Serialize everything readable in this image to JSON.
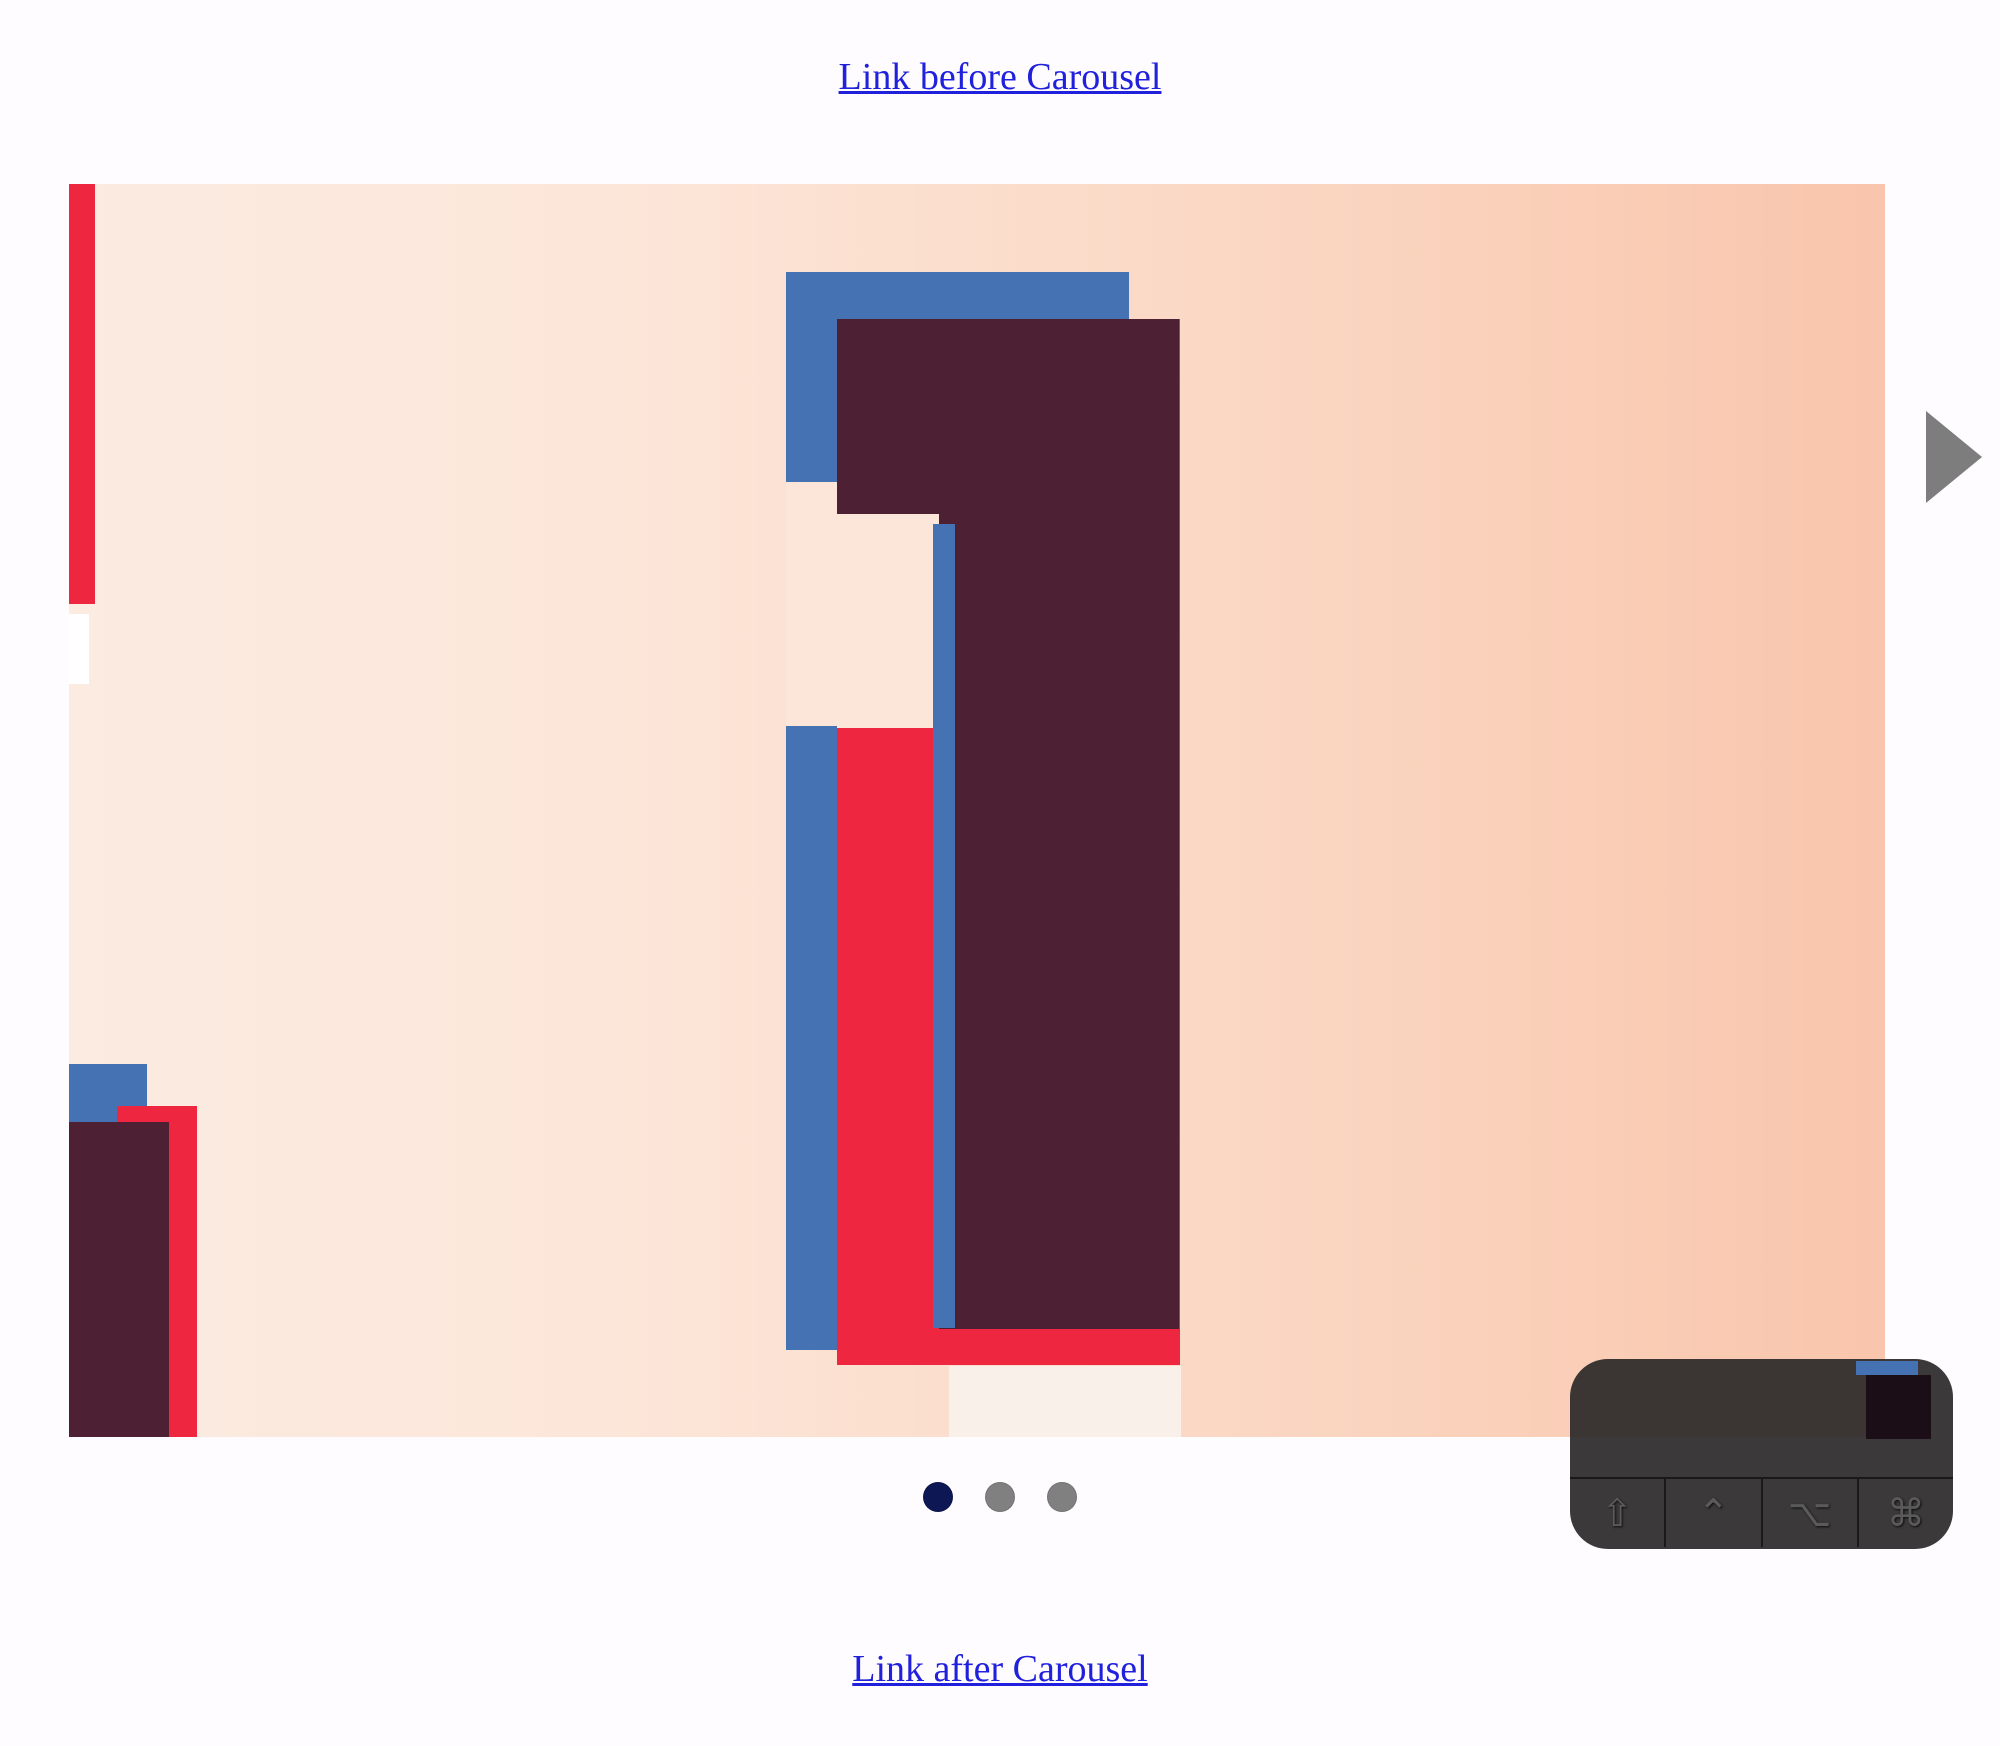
{
  "links": {
    "before": "Link before Carousel",
    "after": "Link after Carousel"
  },
  "carousel": {
    "current_slide": 1,
    "total_slides": 3,
    "dots": [
      {
        "active": true
      },
      {
        "active": false
      },
      {
        "active": false
      }
    ]
  },
  "modifier_keys": {
    "shift": "⇧",
    "control": "⌃",
    "option": "⌥",
    "command": "⌘"
  }
}
